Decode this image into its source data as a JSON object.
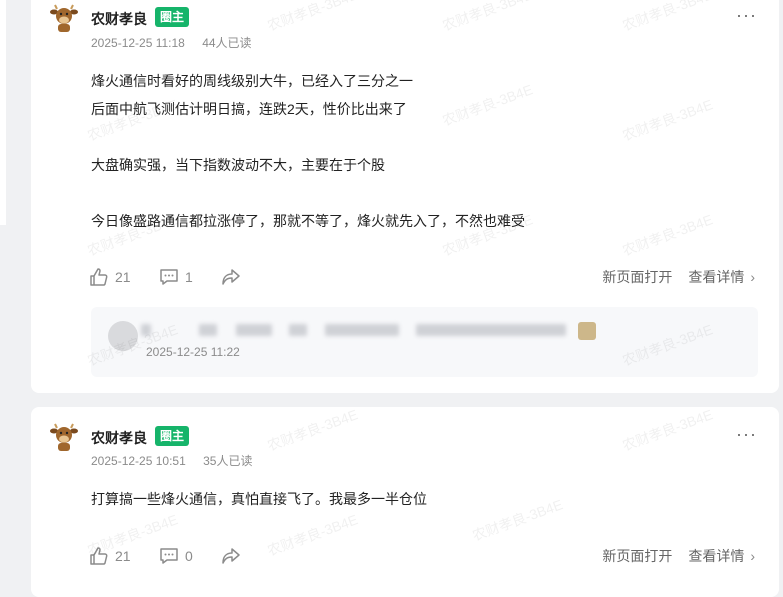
{
  "posts": [
    {
      "author": "农财孝良",
      "badge": "圈主",
      "date": "2025-12-25 11:18",
      "reads": "44人已读",
      "lines": [
        "烽火通信时看好的周线级别大牛，已经入了三分之一",
        "后面中航飞测估计明日搞，连跌2天，性价比出来了",
        "大盘确实强，当下指数波动不大，主要在于个股",
        "今日像盛路通信都拉涨停了，那就不等了，烽火就先入了，不然也难受"
      ],
      "likes": "21",
      "comments": "1",
      "open_new": "新页面打开",
      "details": "查看详情",
      "comment": {
        "time": "2025-12-25 11:22"
      }
    },
    {
      "author": "农财孝良",
      "badge": "圈主",
      "date": "2025-12-25 10:51",
      "reads": "35人已读",
      "lines": [
        "打算搞一些烽火通信，真怕直接飞了。我最多一半仓位"
      ],
      "likes": "21",
      "comments": "0",
      "open_new": "新页面打开",
      "details": "查看详情"
    }
  ],
  "more_symbol": "···",
  "chevron": "›",
  "watermark": "农财孝良-3B4E",
  "colors": {
    "badge": "#16b46a",
    "background": "#f0f1f3"
  }
}
